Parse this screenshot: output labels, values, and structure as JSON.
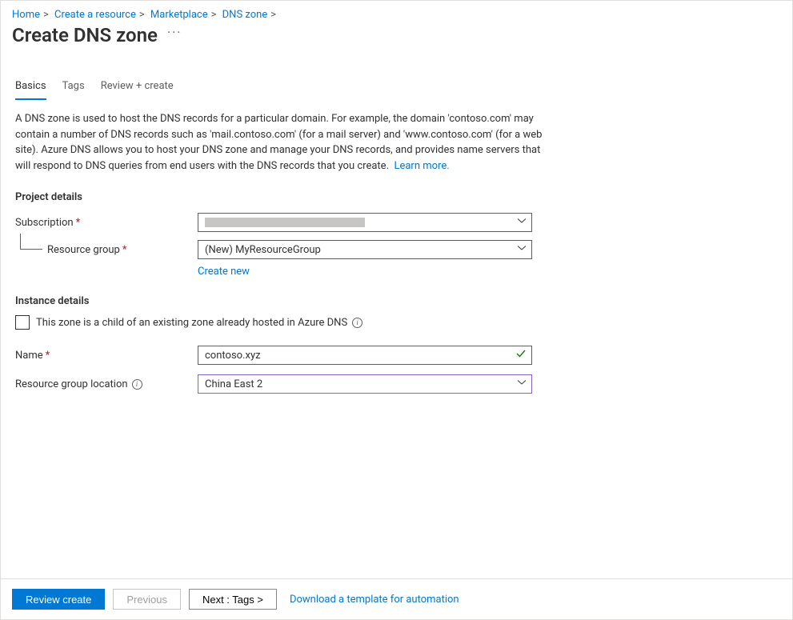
{
  "breadcrumb": {
    "items": [
      "Home",
      "Create a resource",
      "Marketplace",
      "DNS zone"
    ]
  },
  "page_title": "Create DNS zone",
  "tabs": {
    "items": [
      "Basics",
      "Tags",
      "Review + create"
    ],
    "active_index": 0
  },
  "description": {
    "text": "A DNS zone is used to host the DNS records for a particular domain. For example, the domain 'contoso.com' may contain a number of DNS records such as 'mail.contoso.com' (for a mail server) and 'www.contoso.com' (for a web site). Azure DNS allows you to host your DNS zone and manage your DNS records, and provides name servers that will respond to DNS queries from end users with the DNS records that you create.",
    "learn_more": "Learn more."
  },
  "sections": {
    "project_details": "Project details",
    "instance_details": "Instance details"
  },
  "form": {
    "subscription": {
      "label": "Subscription",
      "value": ""
    },
    "resource_group": {
      "label": "Resource group",
      "value": "(New) MyResourceGroup",
      "create_new": "Create new"
    },
    "child_zone": {
      "label": "This zone is a child of an existing zone already hosted in Azure DNS",
      "checked": false
    },
    "name": {
      "label": "Name",
      "value": "contoso.xyz"
    },
    "location": {
      "label": "Resource group location",
      "value": "China East 2"
    }
  },
  "footer": {
    "review": "Review create",
    "previous": "Previous",
    "next": "Next : Tags >",
    "download": "Download a template for automation"
  }
}
